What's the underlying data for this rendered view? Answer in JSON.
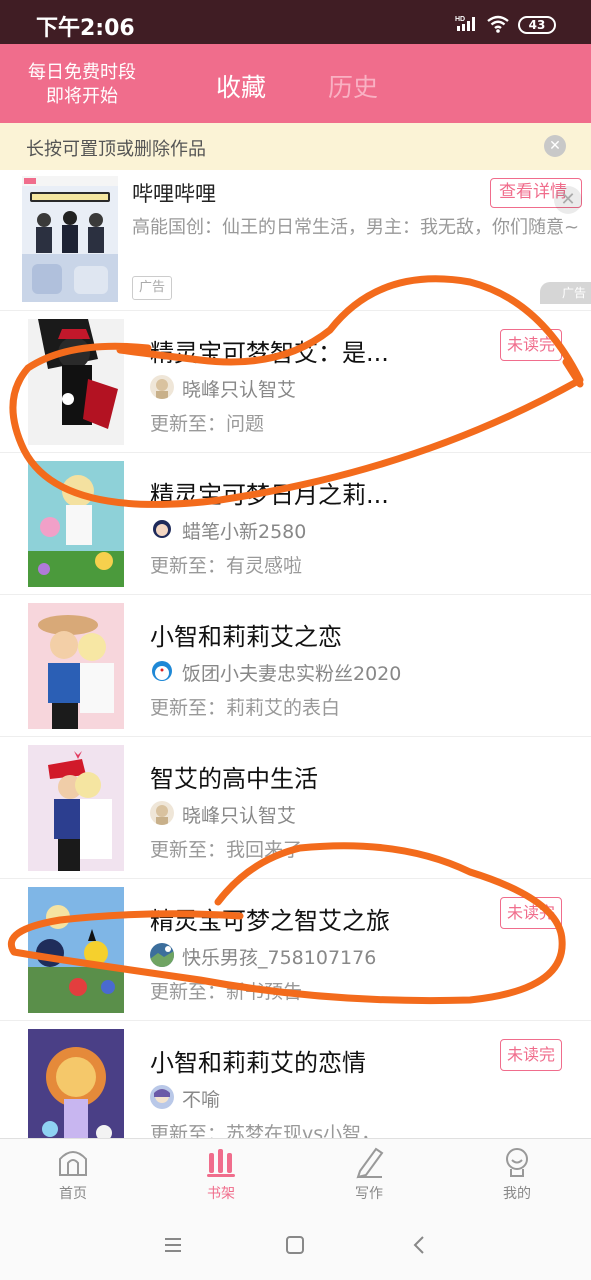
{
  "status_bar": {
    "time": "下午2:06",
    "battery": "43",
    "network": "HD"
  },
  "top_bar": {
    "free_period_line1": "每日免费时段",
    "free_period_line2": "即将开始",
    "tabs": [
      {
        "label": "收藏",
        "active": true
      },
      {
        "label": "历史",
        "active": false
      }
    ]
  },
  "notice": {
    "text": "长按可置顶或删除作品"
  },
  "ad": {
    "title": "哔哩哔哩",
    "description": "高能国创：仙王的日常生活，男主：我无敌，你们随意~",
    "tag": "广告",
    "detail_button": "查看详情",
    "ad_mark": "广告"
  },
  "books": [
    {
      "title": "精灵宝可梦智艾：是...",
      "author": "晓峰只认智艾",
      "update": "更新至：问题",
      "unread": "未读完"
    },
    {
      "title": "精灵宝可梦日月之莉...",
      "author": "蜡笔小新2580",
      "update": "更新至：有灵感啦",
      "unread": ""
    },
    {
      "title": "小智和莉莉艾之恋",
      "author": "饭团小夫妻忠实粉丝2020",
      "update": "更新至：莉莉艾的表白",
      "unread": ""
    },
    {
      "title": "智艾的高中生活",
      "author": "晓峰只认智艾",
      "update": "更新至：我回来了",
      "unread": ""
    },
    {
      "title": "精灵宝可梦之智艾之旅",
      "author": "快乐男孩_758107176",
      "update": "更新至：新书预告",
      "unread": "未读完"
    },
    {
      "title": "小智和莉莉艾的恋情",
      "author": "不喻",
      "update": "更新至：苏梦在现vs小智，",
      "unread": "未读完"
    }
  ],
  "tab_bar": [
    {
      "label": "首页",
      "icon": "home-icon",
      "active": false
    },
    {
      "label": "书架",
      "icon": "bookshelf-icon",
      "active": true
    },
    {
      "label": "写作",
      "icon": "pen-icon",
      "active": false
    },
    {
      "label": "我的",
      "icon": "profile-icon",
      "active": false
    }
  ],
  "colors": {
    "accent": "#f06d8c",
    "status_bar": "#401d24",
    "notice_bg": "#fbf3d6",
    "annotation": "#f36b1c"
  }
}
